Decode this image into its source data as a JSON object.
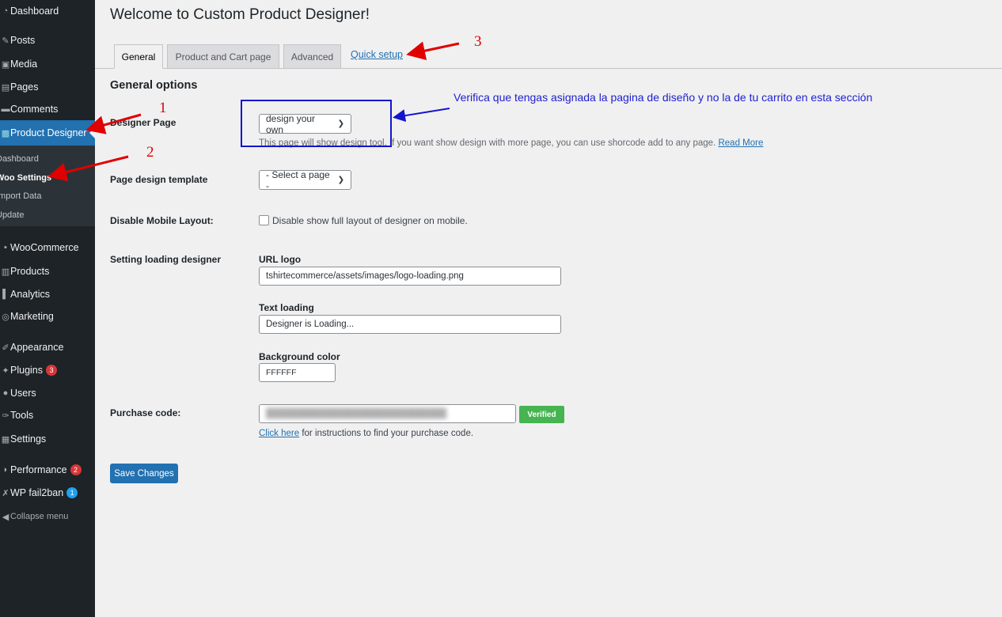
{
  "sidebar": {
    "items": [
      {
        "label": "Dashboard",
        "icon": "dashboard-icon"
      },
      {
        "label": "Posts",
        "icon": "pin-icon"
      },
      {
        "label": "Media",
        "icon": "media-icon"
      },
      {
        "label": "Pages",
        "icon": "pages-icon"
      },
      {
        "label": "Comments",
        "icon": "comments-icon"
      },
      {
        "label": "Product Designer",
        "icon": "designer-icon"
      },
      {
        "label": "WooCommerce",
        "icon": "woo-icon"
      },
      {
        "label": "Products",
        "icon": "products-icon"
      },
      {
        "label": "Analytics",
        "icon": "analytics-icon"
      },
      {
        "label": "Marketing",
        "icon": "marketing-icon"
      },
      {
        "label": "Appearance",
        "icon": "appearance-icon"
      },
      {
        "label": "Plugins",
        "icon": "plugins-icon",
        "badge": "3"
      },
      {
        "label": "Users",
        "icon": "users-icon"
      },
      {
        "label": "Tools",
        "icon": "tools-icon"
      },
      {
        "label": "Settings",
        "icon": "settings-icon"
      },
      {
        "label": "Performance",
        "icon": "performance-icon",
        "badge": "2"
      },
      {
        "label": "WP fail2ban",
        "icon": "fail2ban-icon",
        "badge": "1"
      },
      {
        "label": "Collapse menu",
        "icon": "collapse-icon"
      }
    ],
    "submenu": [
      "Dashboard",
      "Woo Settings",
      "Import Data",
      "Update"
    ]
  },
  "page": {
    "title": "Welcome to Custom Product Designer!",
    "tabs": [
      "General",
      "Product and Cart page",
      "Advanced"
    ],
    "quick_setup": "Quick setup",
    "section_title": "General options"
  },
  "form": {
    "designer_page": {
      "label": "Designer Page",
      "value": "design your own",
      "desc": "This page will show design tool. If you want show design with more page, you can use shorcode add to any page.",
      "read_more": "Read More"
    },
    "page_template": {
      "label": "Page design template",
      "value": "- Select a page -"
    },
    "mobile": {
      "label": "Disable Mobile Layout:",
      "checkbox_label": "Disable show full layout of designer on mobile.",
      "checked": false
    },
    "loading": {
      "label": "Setting loading designer",
      "url_logo_label": "URL logo",
      "url_logo_value": "tshirtecommerce/assets/images/logo-loading.png",
      "text_loading_label": "Text loading",
      "text_loading_value": "Designer is Loading...",
      "bg_color_label": "Background color",
      "bg_color_value": "FFFFFF"
    },
    "purchase": {
      "label": "Purchase code:",
      "verified": "Verified",
      "click_here": "Click here",
      "instructions": " for instructions to find your purchase code."
    },
    "save": "Save Changes"
  },
  "annotations": {
    "note": "Verifica que tengas asignada la pagina de diseño y no la de tu carrito en esta sección",
    "num1": "1",
    "num2": "2",
    "num3": "3"
  },
  "colors": {
    "accent": "#2271b1",
    "sidebar": "#1d2327",
    "red_arrow": "#e00000",
    "blue_annotation": "#1414cc",
    "verified": "#46b450"
  }
}
